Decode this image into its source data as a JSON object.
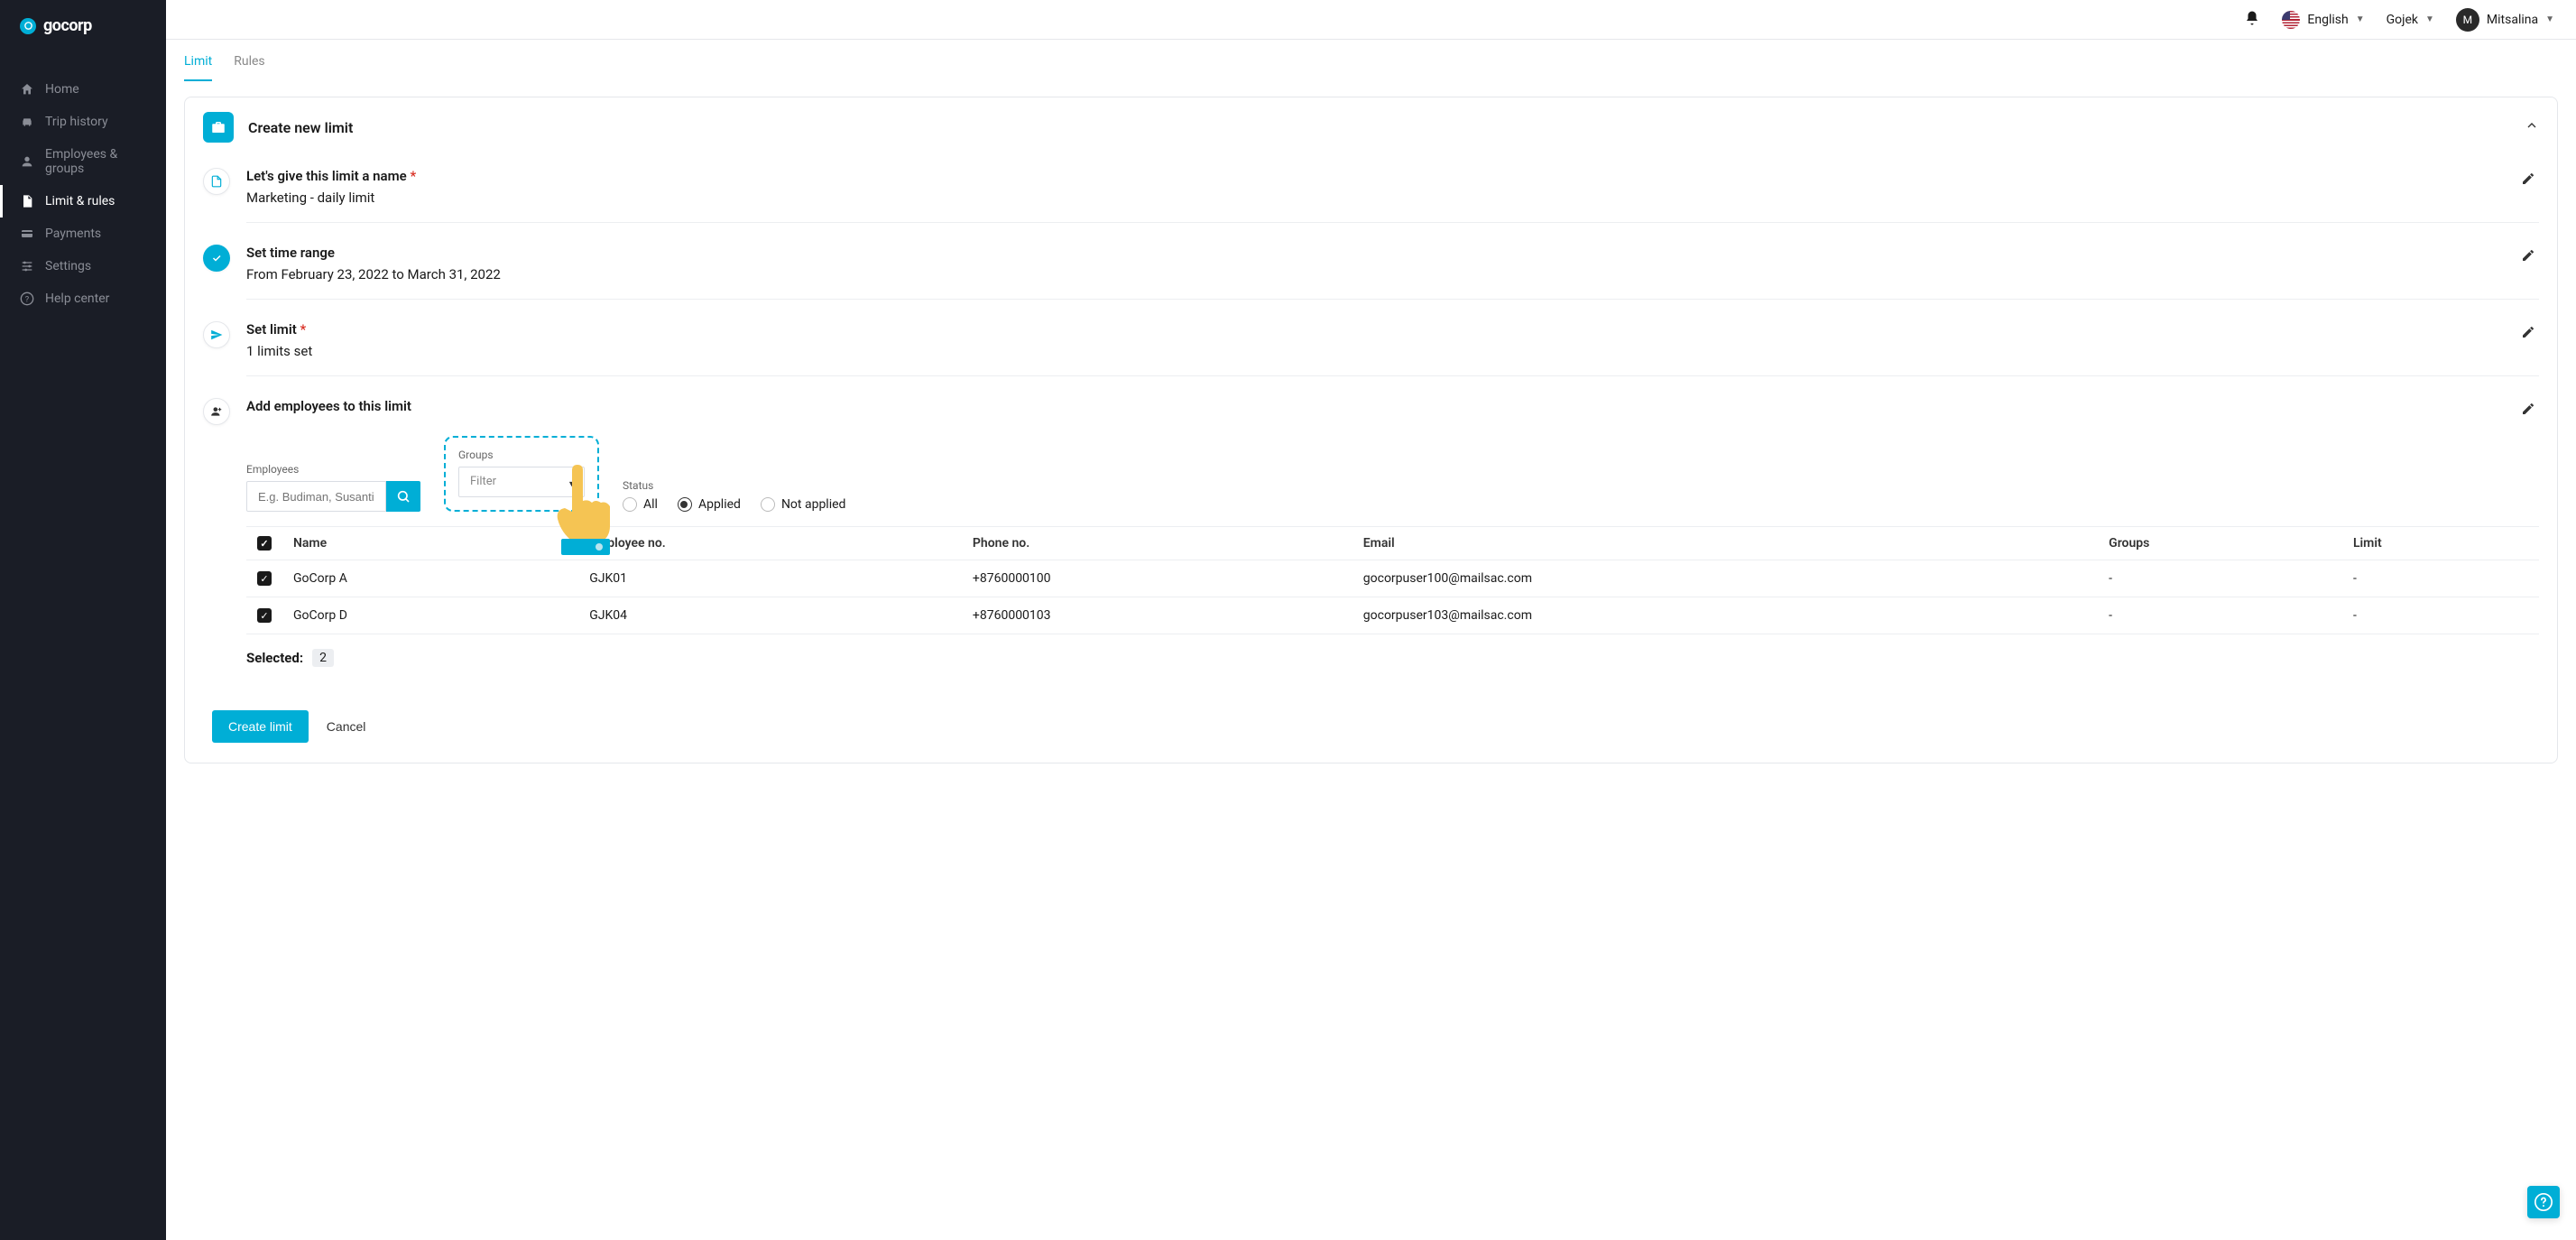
{
  "brand": "gocorp",
  "sidebar": {
    "items": [
      {
        "label": "Home",
        "icon": "home"
      },
      {
        "label": "Trip history",
        "icon": "car"
      },
      {
        "label": "Employees & groups",
        "icon": "user"
      },
      {
        "label": "Limit & rules",
        "icon": "file",
        "active": true
      },
      {
        "label": "Payments",
        "icon": "card"
      },
      {
        "label": "Settings",
        "icon": "sliders"
      },
      {
        "label": "Help center",
        "icon": "help"
      }
    ]
  },
  "topbar": {
    "language": "English",
    "company": "Gojek",
    "user_initial": "M",
    "user_name": "Mitsalina"
  },
  "tabs": {
    "limit": "Limit",
    "rules": "Rules"
  },
  "panel": {
    "title": "Create new limit"
  },
  "steps": {
    "name": {
      "title": "Let's give this limit a name",
      "value": "Marketing - daily limit"
    },
    "time": {
      "title": "Set time range",
      "value": "From February 23, 2022 to March 31, 2022"
    },
    "limit": {
      "title": "Set limit",
      "value": "1 limits set"
    },
    "employees": {
      "title": "Add employees to this limit"
    }
  },
  "filters": {
    "employees_label": "Employees",
    "employees_placeholder": "E.g. Budiman, Susanti",
    "groups_label": "Groups",
    "groups_placeholder": "Filter",
    "status_label": "Status",
    "status_all": "All",
    "status_applied": "Applied",
    "status_not_applied": "Not applied"
  },
  "table": {
    "headers": {
      "name": "Name",
      "emp_no": "Employee no.",
      "phone": "Phone no.",
      "email": "Email",
      "groups": "Groups",
      "limit": "Limit"
    },
    "rows": [
      {
        "name": "GoCorp A",
        "emp_no": "GJK01",
        "phone": "+8760000100",
        "email": "gocorpuser100@mailsac.com",
        "groups": "-",
        "limit": "-"
      },
      {
        "name": "GoCorp D",
        "emp_no": "GJK04",
        "phone": "+8760000103",
        "email": "gocorpuser103@mailsac.com",
        "groups": "-",
        "limit": "-"
      }
    ]
  },
  "selected": {
    "label": "Selected:",
    "count": "2"
  },
  "actions": {
    "create": "Create limit",
    "cancel": "Cancel"
  }
}
